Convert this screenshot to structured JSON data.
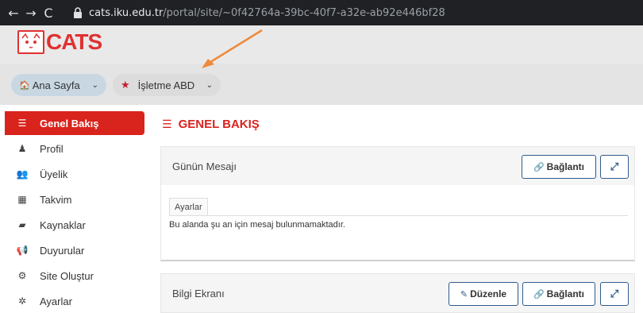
{
  "browser": {
    "back_glyph": "←",
    "forward_glyph": "→",
    "reload_glyph": "C",
    "url_host": "cats.iku.edu.tr",
    "url_path": "/portal/site/~0f42764a-39bc-40f7-a32e-ab92e446bf28"
  },
  "header": {
    "logo_text": "CATS"
  },
  "breadcrumb": {
    "home_label": "Ana Sayfa",
    "site_label": "İşletme ABD",
    "caret": "⌄"
  },
  "sidebar": {
    "items": [
      {
        "label": "Genel Bakış",
        "icon": "list-icon",
        "glyph": "☰",
        "active": true
      },
      {
        "label": "Profil",
        "icon": "user-icon",
        "glyph": "♟"
      },
      {
        "label": "Üyelik",
        "icon": "users-icon",
        "glyph": "👥"
      },
      {
        "label": "Takvim",
        "icon": "calendar-icon",
        "glyph": "▦"
      },
      {
        "label": "Kaynaklar",
        "icon": "folder-icon",
        "glyph": "▰"
      },
      {
        "label": "Duyurular",
        "icon": "bullhorn-icon",
        "glyph": "📢"
      },
      {
        "label": "Site Oluştur",
        "icon": "cogs-icon",
        "glyph": "⚙"
      },
      {
        "label": "Ayarlar",
        "icon": "gear-icon",
        "glyph": "✲"
      }
    ]
  },
  "main": {
    "title": "GENEL BAKIŞ",
    "title_glyph": "☰",
    "panel1": {
      "title": "Günün Mesajı",
      "link_button": "Bağlantı",
      "tab_label": "Ayarlar",
      "message": "Bu alanda şu an için mesaj bulunmamaktadır."
    },
    "panel2": {
      "title": "Bilgi Ekranı",
      "edit_button": "Düzenle",
      "link_button": "Bağlantı"
    }
  },
  "colors": {
    "accent": "#d9231d",
    "header_bg": "#e9e9e9",
    "button_border": "#2f5b8c"
  }
}
